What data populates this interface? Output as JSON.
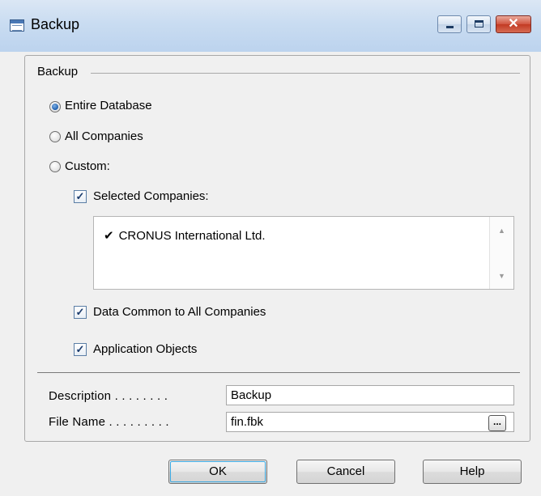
{
  "window": {
    "title": "Backup",
    "close_glyph": "✕"
  },
  "backup_group": {
    "label": "Backup",
    "options": [
      {
        "label": "Entire Database",
        "selected": true
      },
      {
        "label": "All Companies",
        "selected": false
      },
      {
        "label": "Custom:",
        "selected": false
      }
    ]
  },
  "custom": {
    "selected_companies": {
      "label": "Selected Companies:",
      "checked": true
    },
    "companies": [
      {
        "tick": "✔",
        "name": "CRONUS International Ltd."
      }
    ],
    "data_common": {
      "label": "Data Common to All Companies",
      "checked": true
    },
    "application_objects": {
      "label": "Application Objects",
      "checked": true
    }
  },
  "fields": {
    "description": {
      "label": "Description . . . . . . . .",
      "value": "Backup"
    },
    "file_name": {
      "label": "File Name . . . . . . . . .",
      "value": "fin.fbk",
      "browse": "..."
    }
  },
  "buttons": {
    "ok": "OK",
    "cancel": "Cancel",
    "help": "Help"
  },
  "icons": {
    "window_icon": "form-icon",
    "scroll_up": "▲",
    "scroll_down": "▼",
    "check_glyph": "✓"
  }
}
